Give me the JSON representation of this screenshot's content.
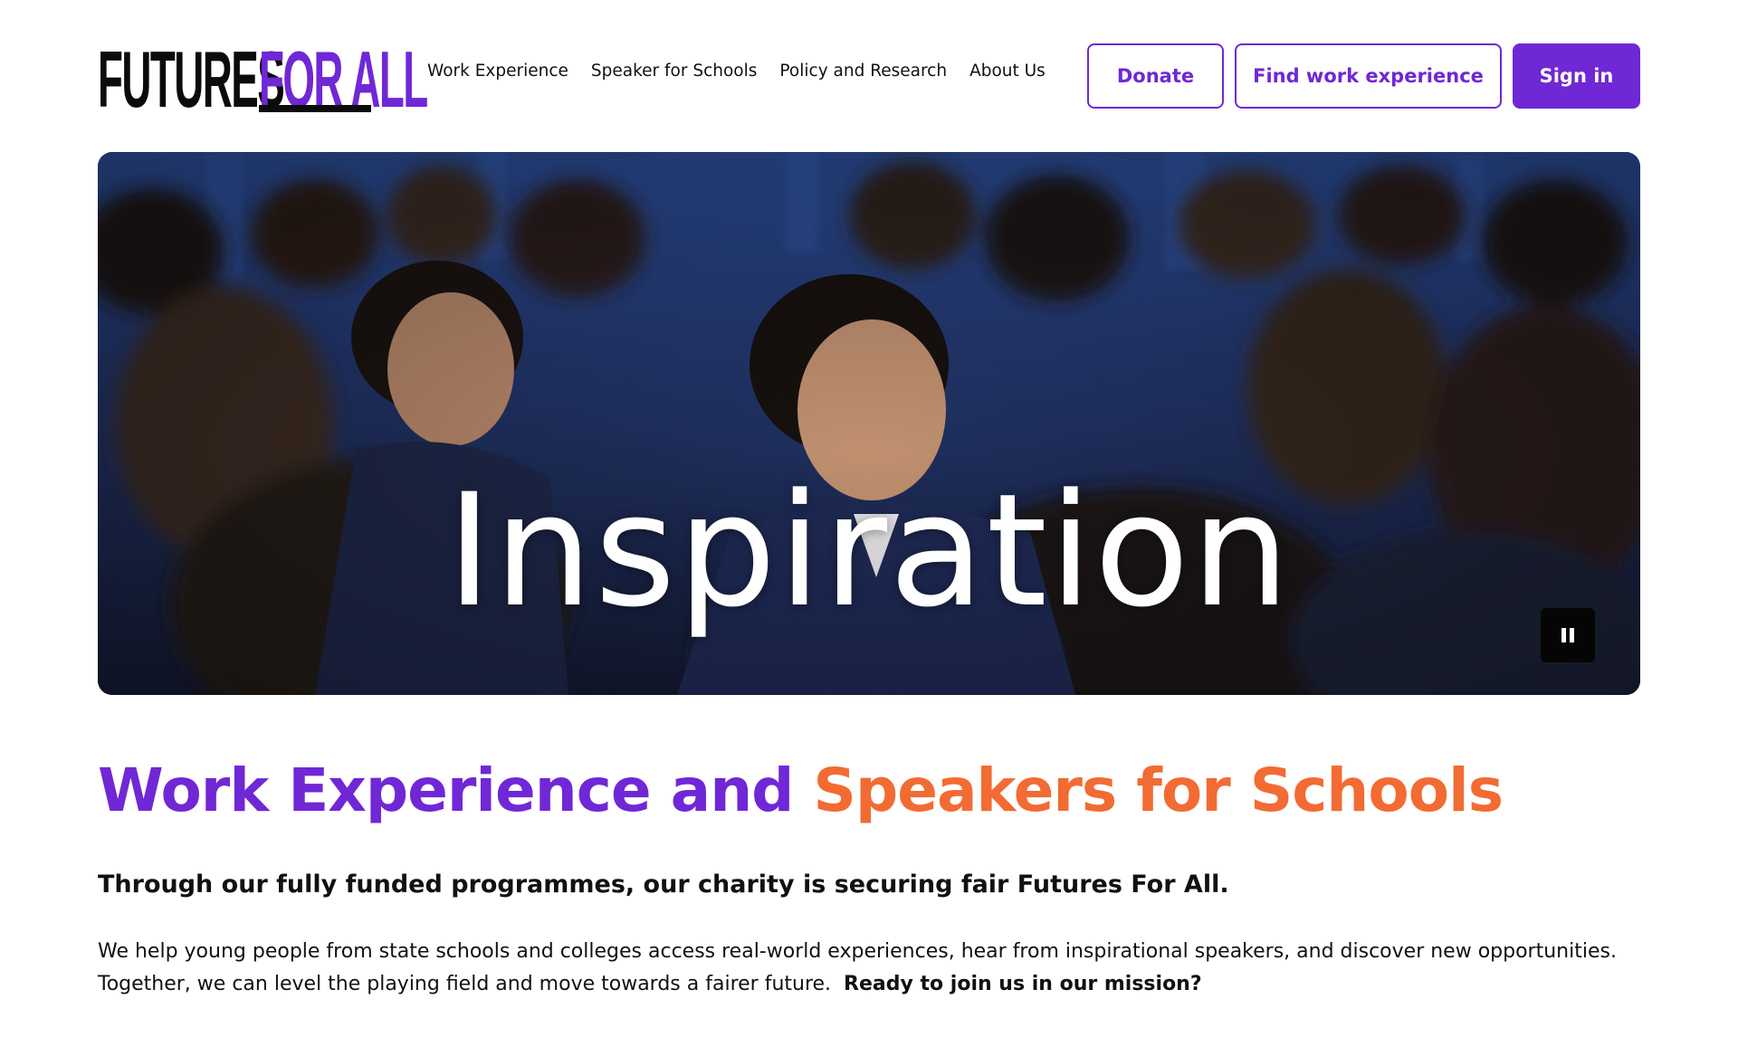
{
  "brand": {
    "logo_word_1": "FUTURES",
    "logo_word_2": "FOR ALL",
    "accent_color": "#7027d6",
    "secondary_color": "#f26b33"
  },
  "nav": {
    "items": [
      {
        "label": "Work Experience"
      },
      {
        "label": "Speaker for Schools"
      },
      {
        "label": "Policy and Research"
      },
      {
        "label": "About Us"
      }
    ]
  },
  "actions": {
    "donate_label": "Donate",
    "find_label": "Find work experience",
    "signin_label": "Sign in"
  },
  "hero": {
    "overlay_word": "Inspiration",
    "pause_icon": "pause-icon"
  },
  "main": {
    "headline_part_1": "Work Experience and",
    "headline_part_2": "Speakers for Schools",
    "subheading": "Through our fully funded programmes, our charity is securing fair Futures For All.",
    "body_text": "We help young people from state schools and colleges access real-world experiences, hear from inspirational speakers, and discover new opportunities. Together, we can level the playing field and move towards a fairer future.",
    "body_cta": "Ready to join us in our mission?"
  }
}
